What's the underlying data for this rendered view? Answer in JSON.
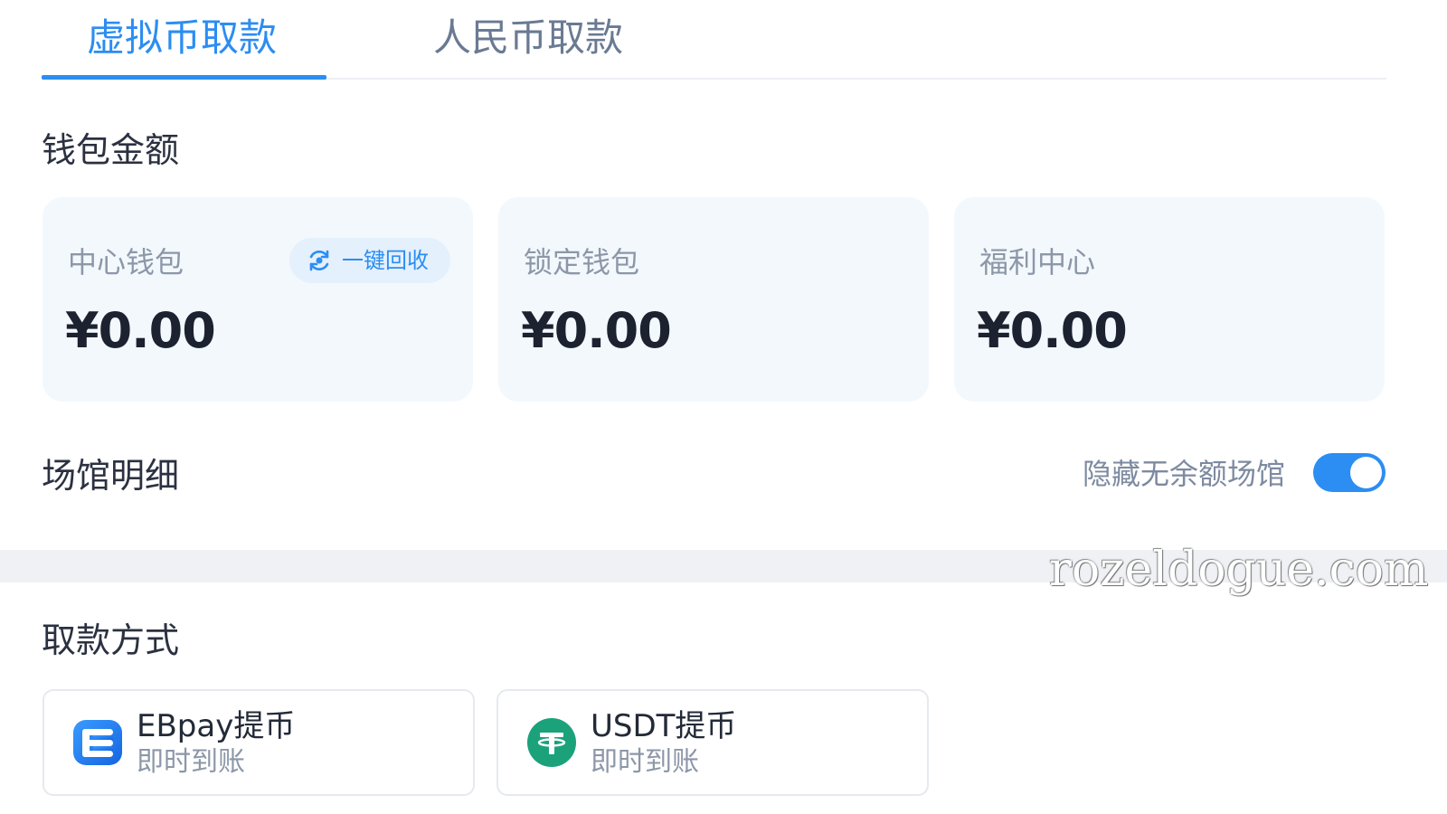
{
  "tabs": [
    {
      "label": "虚拟币取款",
      "active": true
    },
    {
      "label": "人民币取款",
      "active": false
    }
  ],
  "wallet_section": {
    "title": "钱包金额",
    "cards": [
      {
        "label": "中心钱包",
        "amount": "¥0.00",
        "action_label": "一键回收"
      },
      {
        "label": "锁定钱包",
        "amount": "¥0.00"
      },
      {
        "label": "福利中心",
        "amount": "¥0.00"
      }
    ]
  },
  "venue_section": {
    "title": "场馆明细",
    "toggle_label": "隐藏无余额场馆",
    "toggle_on": true
  },
  "withdraw_section": {
    "title": "取款方式",
    "methods": [
      {
        "name": "EBpay提币",
        "sub": "即时到账",
        "icon": "ebpay-logo-icon"
      },
      {
        "name": "USDT提币",
        "sub": "即时到账",
        "icon": "tether-logo-icon"
      }
    ]
  },
  "watermark": "rozeldogue.com",
  "colors": {
    "accent": "#2c8df2",
    "card_bg": "#f3f8fd",
    "tether_green": "#1ba27a"
  }
}
